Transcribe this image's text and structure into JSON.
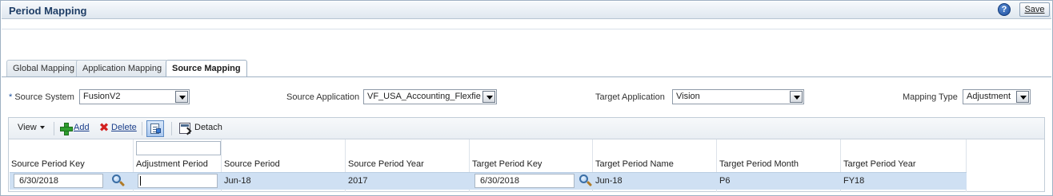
{
  "header": {
    "title": "Period Mapping",
    "help_icon": "help-icon",
    "save_label": "Save"
  },
  "tabs": [
    {
      "label": "Global Mapping",
      "active": false
    },
    {
      "label": "Application Mapping",
      "active": false
    },
    {
      "label": "Source Mapping",
      "active": true
    }
  ],
  "form": {
    "source_system": {
      "required_marker": "*",
      "label": "Source System",
      "value": "FusionV2"
    },
    "source_application": {
      "label": "Source Application",
      "value": "VF_USA_Accounting_Flexfie"
    },
    "target_application": {
      "label": "Target Application",
      "value": "Vision"
    },
    "mapping_type": {
      "label": "Mapping Type",
      "value": "Adjustment"
    }
  },
  "toolbar": {
    "view_label": "View",
    "add_label": "Add",
    "delete_label": "Delete",
    "detach_label": "Detach"
  },
  "table": {
    "columns": [
      "Source Period Key",
      "Adjustment Period",
      "Source Period",
      "Source Period Year",
      "Target Period Key",
      "Target Period Name",
      "Target Period Month",
      "Target Period Year"
    ],
    "rows": [
      {
        "source_period_key": "6/30/2018",
        "adjustment_period": "",
        "source_period": "Jun-18",
        "source_period_year": "2017",
        "target_period_key": "6/30/2018",
        "target_period_name": "Jun-18",
        "target_period_month": "P6",
        "target_period_year": "FY18"
      }
    ]
  },
  "colors": {
    "title": "#1f3e66",
    "selected_row": "#cfe0f3",
    "link": "#1b3f8b",
    "add_icon": "#2f9e2f",
    "delete_icon": "#d22020"
  }
}
